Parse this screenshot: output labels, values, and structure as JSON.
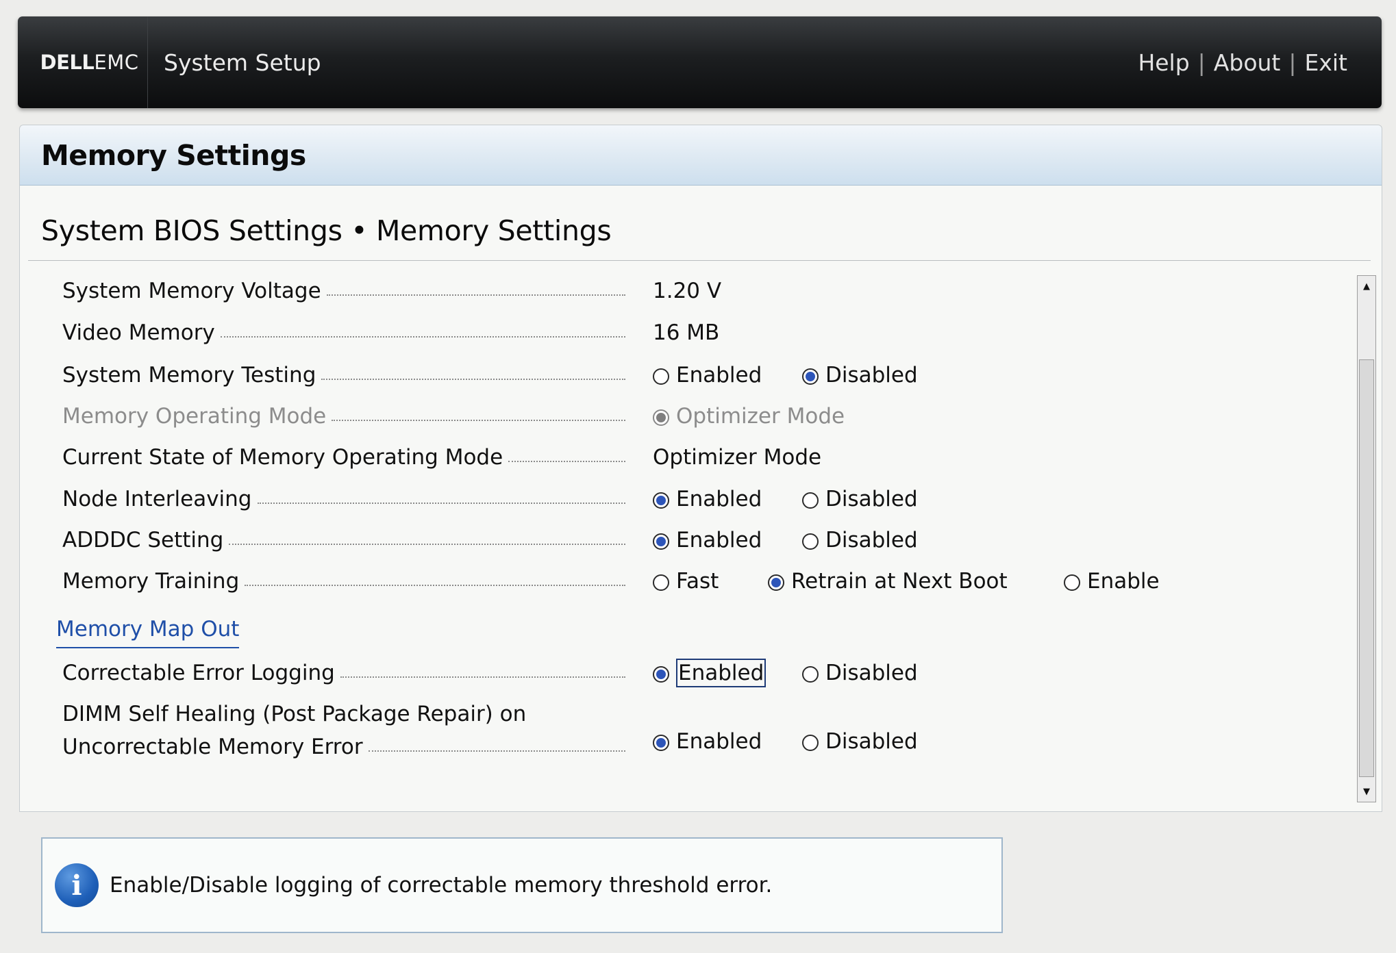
{
  "header": {
    "logo_dell": "DELL",
    "logo_emc": "EMC",
    "title": "System Setup",
    "links": [
      "Help",
      "About",
      "Exit"
    ],
    "separator": "|"
  },
  "panel": {
    "title": "Memory Settings",
    "breadcrumb": "System BIOS Settings • Memory Settings"
  },
  "settings": [
    {
      "label": "System Memory Voltage",
      "value": "1.20 V"
    },
    {
      "label": "Video Memory",
      "value": "16 MB"
    },
    {
      "label": "System Memory Testing",
      "options": [
        "Enabled",
        "Disabled"
      ],
      "selected": "Disabled"
    },
    {
      "label": "Memory Operating Mode",
      "options": [
        "Optimizer Mode"
      ],
      "selected": "Optimizer Mode",
      "disabled": true
    },
    {
      "label": "Current State of Memory Operating Mode",
      "value": "Optimizer Mode"
    },
    {
      "label": "Node Interleaving",
      "options": [
        "Enabled",
        "Disabled"
      ],
      "selected": "Enabled"
    },
    {
      "label": "ADDDC Setting",
      "options": [
        "Enabled",
        "Disabled"
      ],
      "selected": "Enabled"
    },
    {
      "label": "Memory Training",
      "options": [
        "Fast",
        "Retrain at Next Boot",
        "Enable"
      ],
      "selected": "Retrain at Next Boot"
    }
  ],
  "section": {
    "link": "Memory Map Out"
  },
  "settings2": [
    {
      "label": "Correctable Error Logging",
      "options": [
        "Enabled",
        "Disabled"
      ],
      "selected": "Enabled",
      "focused": "Enabled"
    },
    {
      "label_line1": "DIMM Self Healing (Post Package Repair) on",
      "label_line2": "Uncorrectable Memory Error",
      "options": [
        "Enabled",
        "Disabled"
      ],
      "selected": "Enabled"
    }
  ],
  "help": {
    "icon": "info-icon",
    "text": "Enable/Disable logging of correctable memory threshold error."
  },
  "colors": {
    "accent": "#2d55b9",
    "link": "#1f4fa8",
    "topbar": "#1c1e20"
  }
}
